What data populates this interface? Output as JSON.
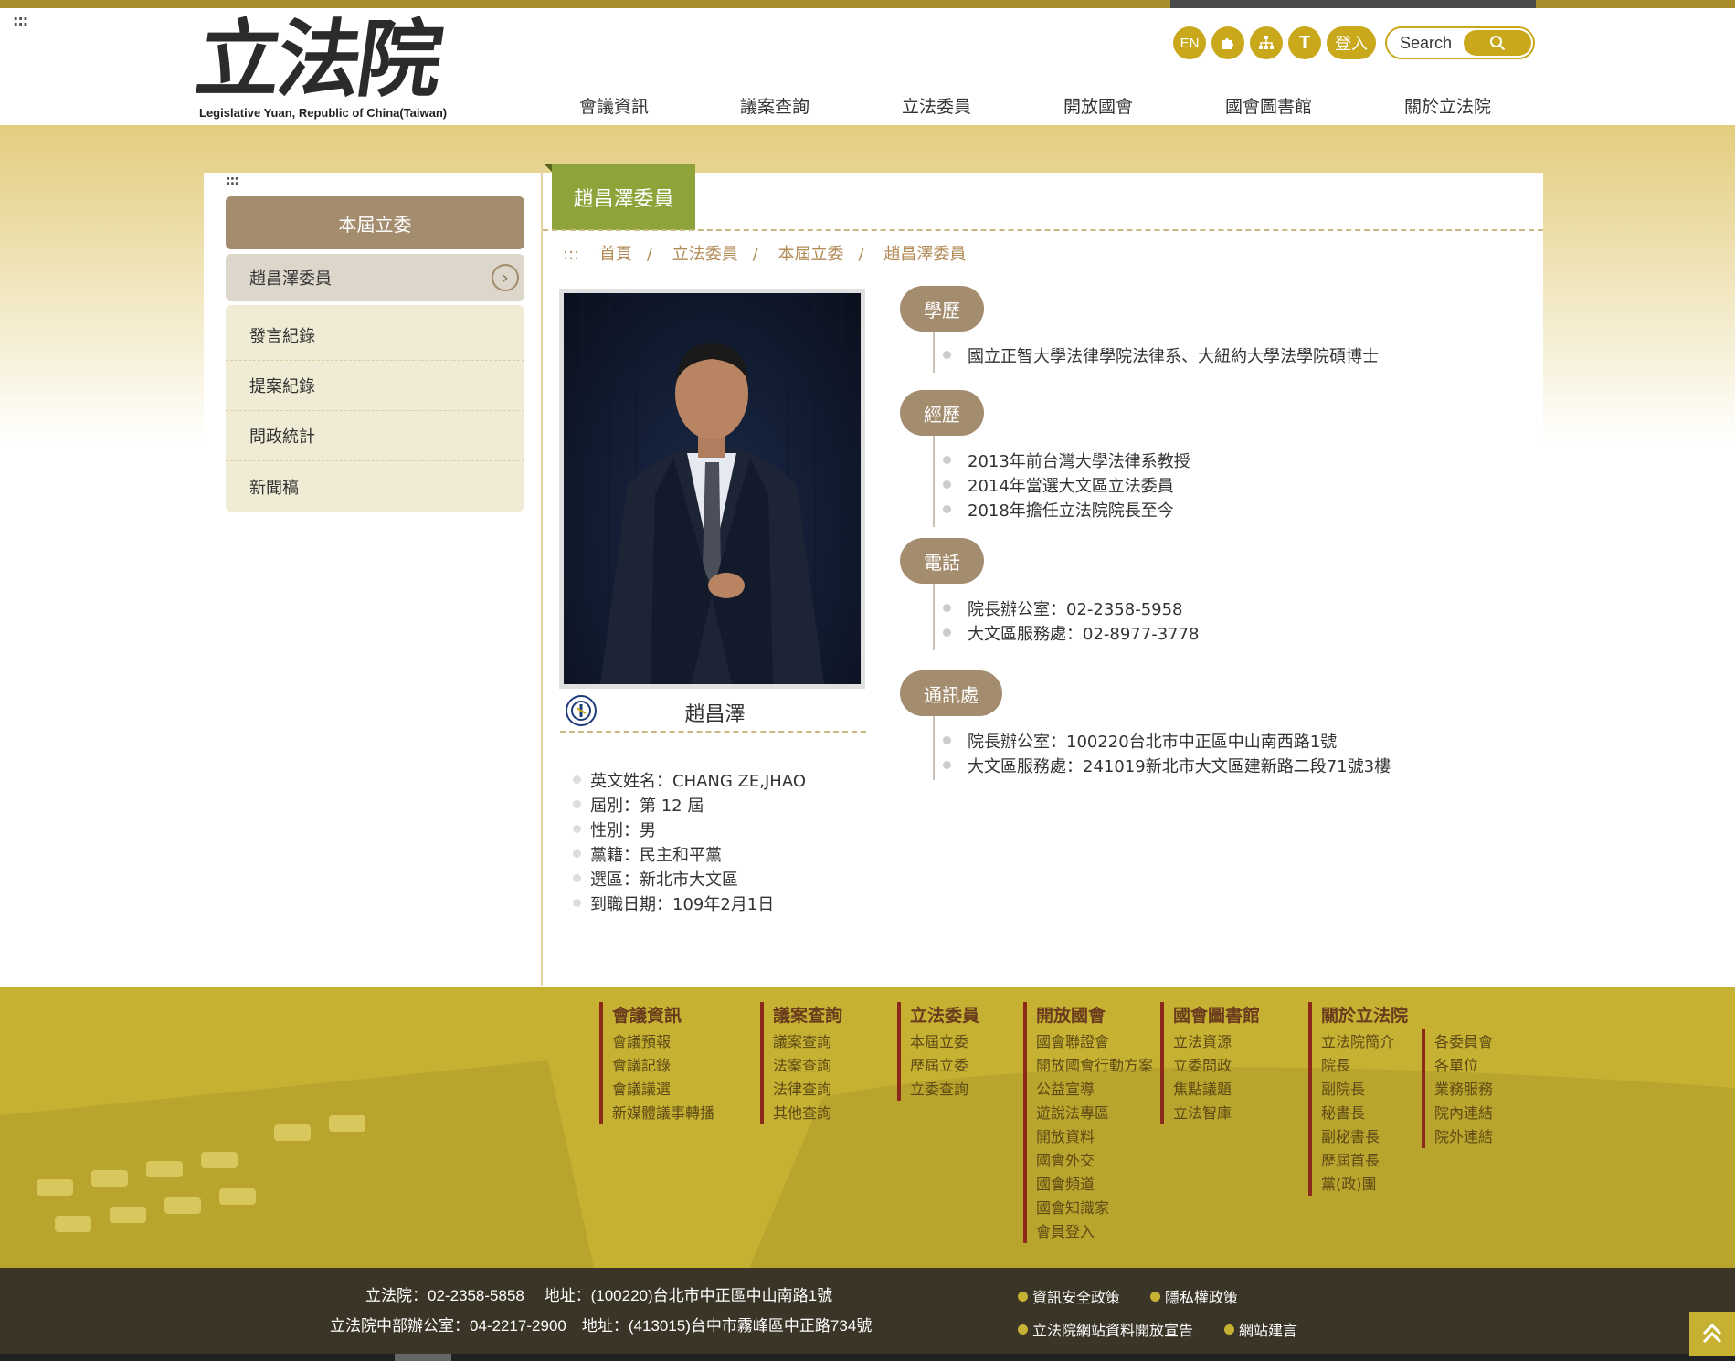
{
  "header": {
    "logo_cn": "立法院",
    "logo_en": "Legislative Yuan, Republic of China(Taiwan)",
    "skip": ":::",
    "tools": [
      "EN",
      "T"
    ],
    "login": "登入",
    "search_placeholder": "Search"
  },
  "nav": [
    "會議資訊",
    "議案查詢",
    "立法委員",
    "開放國會",
    "國會圖書館",
    "關於立法院"
  ],
  "sidebar": {
    "skip": ":::",
    "title": "本屆立委",
    "current": "趙昌澤委員",
    "items": [
      "發言紀錄",
      "提案紀錄",
      "問政統計",
      "新聞稿"
    ]
  },
  "page": {
    "title": "趙昌澤委員",
    "breadcrumb_skip": ":::",
    "breadcrumb": [
      "首頁",
      "立法委員",
      "本屆立委",
      "趙昌澤委員"
    ]
  },
  "profile": {
    "name": "趙昌澤",
    "info": [
      "英文姓名：CHANG ZE,JHAO",
      "屆別：第 12 屆",
      "性別：男",
      "黨籍：民主和平黨",
      "選區：新北市大文區",
      "到職日期：109年2月1日"
    ],
    "sections": [
      {
        "title": "學歷",
        "items": [
          "國立正智大學法律學院法律系、大紐約大學法學院碩博士"
        ]
      },
      {
        "title": "經歷",
        "items": [
          "2013年前台灣大學法律系教授",
          "2014年當選大文區立法委員",
          "2018年擔任立法院院長至今"
        ]
      },
      {
        "title": "電話",
        "items": [
          "院長辦公室：02-2358-5958",
          "大文區服務處：02-8977-3778"
        ]
      },
      {
        "title": "通訊處",
        "items": [
          "院長辦公室：100220台北市中正區中山南西路1號",
          "大文區服務處：241019新北市大文區建新路二段71號3樓"
        ]
      }
    ]
  },
  "footer": {
    "columns": [
      {
        "title": "會議資訊",
        "links": [
          "會議預報",
          "會議記錄",
          "會議議選",
          "新媒體議事轉播"
        ]
      },
      {
        "title": "議案查詢",
        "links": [
          "議案查詢",
          "法案查詢",
          "法律查詢",
          "其他查詢"
        ]
      },
      {
        "title": "立法委員",
        "links": [
          "本屆立委",
          "歷屆立委",
          "立委查詢"
        ]
      },
      {
        "title": "開放國會",
        "links": [
          "國會聯證會",
          "開放國會行動方案",
          "公益宣導",
          "遊說法專區",
          "開放資料",
          "國會外交",
          "國會頻道",
          "國會知識家",
          "會員登入"
        ]
      },
      {
        "title": "國會圖書館",
        "links": [
          "立法資源",
          "立委問政",
          "焦點議題",
          "立法智庫"
        ]
      },
      {
        "title": "關於立法院",
        "links": [
          "立法院簡介",
          "院長",
          "副院長",
          "秘書長",
          "副秘書長",
          "歷屆首長",
          "黨(政)團"
        ]
      }
    ],
    "extra_links": [
      "各委員會",
      "各單位",
      "業務服務",
      "院內連結",
      "院外連結"
    ],
    "address": [
      "立法院：02-2358-5858　 地址：(100220)台北市中正區中山南路1號",
      "立法院中部辦公室：04-2217-2900　地址：(413015)台中市霧峰區中正路734號"
    ],
    "policies": [
      "資訊安全政策",
      "隱私權政策",
      "立法院網站資料開放宣告",
      "網站建言"
    ]
  },
  "colors": {
    "brand": "#c9a81c",
    "tab_green": "#8ea43a",
    "pill": "#a38d6e",
    "footer": "#c6b133"
  }
}
